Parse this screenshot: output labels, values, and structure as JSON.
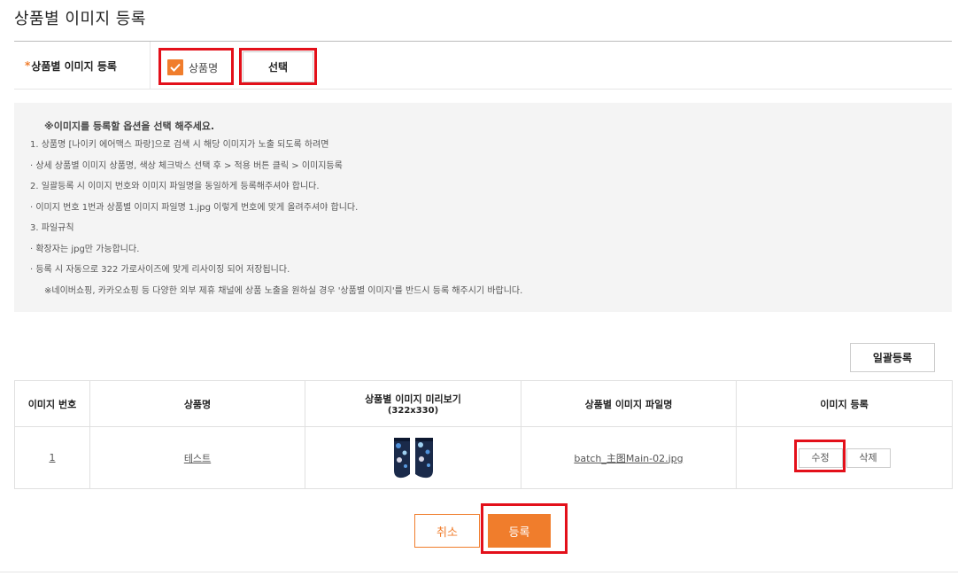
{
  "page": {
    "title": "상품별 이미지 등록"
  },
  "option": {
    "label_required_mark": "*",
    "label": "상품별 이미지 등록",
    "checkbox_label": "상품명",
    "checkbox_checked": true,
    "select_button": "선택"
  },
  "notice": {
    "heading": "※이미지를 등록할 옵션을 선택 해주세요.",
    "lines": [
      "1. 상품명 [나이키 에어맥스 파랑]으로 검색 시 해당 이미지가 노출 되도록 하려면",
      "· 상세 상품별 이미지 상품명, 색상 체크박스 선택 후 > 적용 버튼 클릭 > 이미지등록",
      "2. 일괄등록 시 이미지 번호와 이미지 파일명을 동일하게 등록해주셔야 합니다.",
      "· 이미지 번호 1번과 상품별 이미지 파일명 1.jpg 이렇게 번호에 맞게 올려주셔야 합니다.",
      "3. 파일규칙",
      "· 확장자는 jpg만 가능합니다.",
      "· 등록 시 자동으로 322 가로사이즈에 맞게 리사이징 되어 저장됩니다.",
      "※네이버쇼핑, 카카오쇼핑 등 다양한 외부 제휴 채널에 상품 노출을 원하실 경우 '상품별 이미지'를 반드시 등록 해주시기 바랍니다."
    ]
  },
  "bulk_button": "일괄등록",
  "table": {
    "headers": {
      "number": "이미지 번호",
      "product_name": "상품명",
      "preview": "상품별 이미지 미리보기",
      "preview_size": "(322x330)",
      "file_name": "상품별 이미지 파일명",
      "register": "이미지 등록"
    },
    "rows": [
      {
        "number": "1",
        "product_name": "테스트",
        "file_name": "batch_主图Main-02.jpg",
        "edit": "수정",
        "delete": "삭제"
      }
    ]
  },
  "actions": {
    "cancel": "취소",
    "submit": "등록"
  },
  "colors": {
    "accent": "#f07d2c",
    "highlight": "#e3101a"
  }
}
